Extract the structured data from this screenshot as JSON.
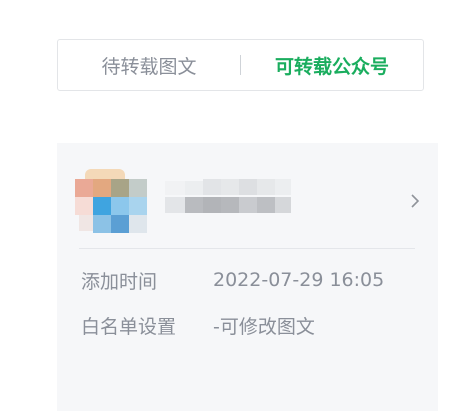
{
  "tabs": [
    {
      "label": "待转载图文",
      "active": false
    },
    {
      "label": "可转载公众号",
      "active": true
    }
  ],
  "account": {
    "name": "",
    "chevron_icon": "chevron-right-icon"
  },
  "details": {
    "added_time_label": "添加时间",
    "added_time_value": "2022-07-29 16:05",
    "whitelist_label": "白名单设置",
    "whitelist_value": "-可修改图文"
  },
  "colors": {
    "accent": "#1aad5e",
    "muted_text": "#8a8f99",
    "card_bg": "#f6f7f9"
  }
}
